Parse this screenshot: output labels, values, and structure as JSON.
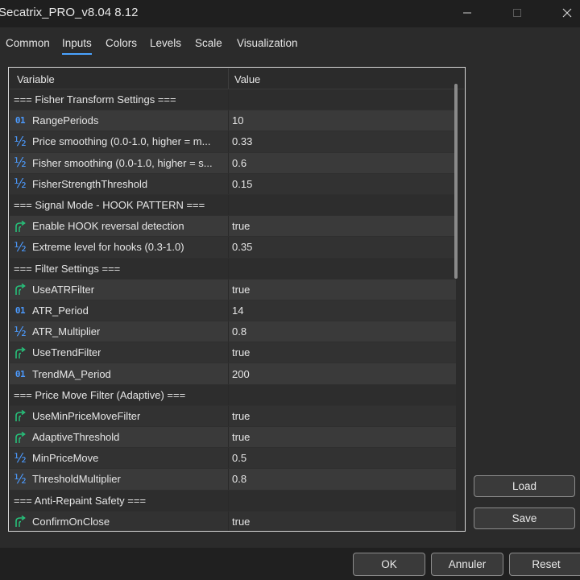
{
  "window": {
    "title": "Secatrix_PRO_v8.04 8.12",
    "controls": [
      "minimize-icon",
      "maximize-icon",
      "close-icon"
    ]
  },
  "tabs": [
    {
      "label": "Common",
      "active": false
    },
    {
      "label": "Inputs",
      "active": true
    },
    {
      "label": "Colors",
      "active": false
    },
    {
      "label": "Levels",
      "active": false
    },
    {
      "label": "Scale",
      "active": false
    },
    {
      "label": "Visualization",
      "active": false
    }
  ],
  "table": {
    "headers": {
      "variable": "Variable",
      "value": "Value"
    },
    "rows": [
      {
        "type": "group",
        "name": "=== Fisher Transform Settings ===",
        "value": ""
      },
      {
        "type": "int",
        "name": "RangePeriods",
        "value": "10"
      },
      {
        "type": "double",
        "name": "Price smoothing (0.0-1.0, higher = m...",
        "value": "0.33"
      },
      {
        "type": "double",
        "name": "Fisher smoothing (0.0-1.0, higher = s...",
        "value": "0.6"
      },
      {
        "type": "double",
        "name": "FisherStrengthThreshold",
        "value": "0.15"
      },
      {
        "type": "group",
        "name": "=== Signal Mode - HOOK PATTERN ===",
        "value": ""
      },
      {
        "type": "bool",
        "name": "Enable HOOK reversal detection",
        "value": "true"
      },
      {
        "type": "double",
        "name": "Extreme level for hooks (0.3-1.0)",
        "value": "0.35"
      },
      {
        "type": "group",
        "name": "=== Filter Settings ===",
        "value": ""
      },
      {
        "type": "bool",
        "name": "UseATRFilter",
        "value": "true"
      },
      {
        "type": "int",
        "name": "ATR_Period",
        "value": "14"
      },
      {
        "type": "double",
        "name": "ATR_Multiplier",
        "value": "0.8"
      },
      {
        "type": "bool",
        "name": "UseTrendFilter",
        "value": "true"
      },
      {
        "type": "int",
        "name": "TrendMA_Period",
        "value": "200"
      },
      {
        "type": "group",
        "name": "=== Price Move Filter (Adaptive) ===",
        "value": ""
      },
      {
        "type": "bool",
        "name": "UseMinPriceMoveFilter",
        "value": "true"
      },
      {
        "type": "bool",
        "name": "AdaptiveThreshold",
        "value": "true"
      },
      {
        "type": "double",
        "name": "MinPriceMove",
        "value": "0.5"
      },
      {
        "type": "double",
        "name": "ThresholdMultiplier",
        "value": "0.8"
      },
      {
        "type": "group",
        "name": "=== Anti-Repaint Safety ===",
        "value": ""
      },
      {
        "type": "bool",
        "name": "ConfirmOnClose",
        "value": "true"
      }
    ]
  },
  "icons": {
    "int": {
      "glyph": "01",
      "color": "#4c9bff",
      "name": "integer-type-icon"
    },
    "double": {
      "glyph": "½",
      "color": "#4c9bff",
      "name": "double-type-icon"
    },
    "bool": {
      "name": "bool-arrow-icon",
      "color": "#27c07a"
    }
  },
  "side_buttons": {
    "load": "Load",
    "save": "Save"
  },
  "footer_buttons": {
    "ok": "OK",
    "cancel": "Annuler",
    "reset": "Reset"
  },
  "colors": {
    "accent": "#4aa3ff",
    "background": "#2b2b2b",
    "titlebar": "#1f1f1f"
  }
}
